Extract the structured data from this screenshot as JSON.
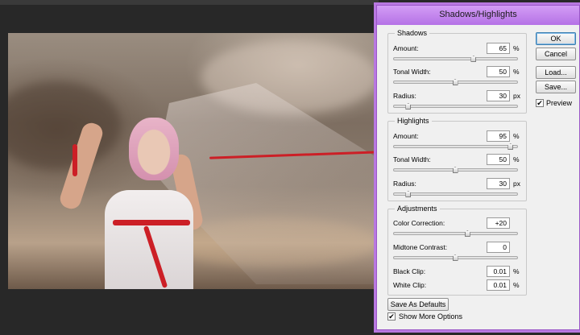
{
  "dialog": {
    "title": "Shadows/Highlights",
    "buttons": {
      "ok": "OK",
      "cancel": "Cancel",
      "load": "Load...",
      "save": "Save..."
    },
    "preview": {
      "label": "Preview",
      "checked": true
    },
    "shadows": {
      "legend": "Shadows",
      "amount": {
        "label": "Amount:",
        "value": "65",
        "unit": "%",
        "level": 0.65
      },
      "tonal_width": {
        "label": "Tonal Width:",
        "value": "50",
        "unit": "%",
        "level": 0.5
      },
      "radius": {
        "label": "Radius:",
        "value": "30",
        "unit": "px",
        "level": 0.12
      }
    },
    "highlights": {
      "legend": "Highlights",
      "amount": {
        "label": "Amount:",
        "value": "95",
        "unit": "%",
        "level": 0.95
      },
      "tonal_width": {
        "label": "Tonal Width:",
        "value": "50",
        "unit": "%",
        "level": 0.5
      },
      "radius": {
        "label": "Radius:",
        "value": "30",
        "unit": "px",
        "level": 0.12
      }
    },
    "adjustments": {
      "legend": "Adjustments",
      "color_correction": {
        "label": "Color Correction:",
        "value": "+20",
        "level": 0.6
      },
      "midtone_contrast": {
        "label": "Midtone Contrast:",
        "value": "0",
        "level": 0.5
      },
      "black_clip": {
        "label": "Black Clip:",
        "value": "0.01",
        "unit": "%"
      },
      "white_clip": {
        "label": "White Clip:",
        "value": "0.01",
        "unit": "%"
      }
    },
    "save_defaults_label": "Save As Defaults",
    "show_more": {
      "label": "Show More Options",
      "checked": true
    }
  },
  "colors": {
    "title_bar": "#b572e6",
    "workspace": "#282828",
    "ribbon": "#cc1f26"
  }
}
